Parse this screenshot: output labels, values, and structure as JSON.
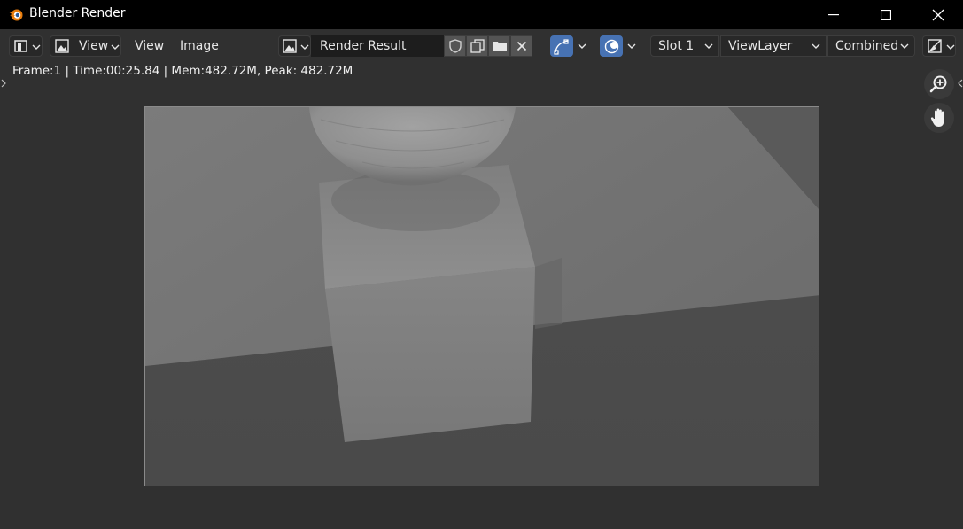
{
  "window": {
    "title": "Blender Render",
    "controls": [
      "minimize-icon",
      "maximize-icon",
      "close-icon"
    ]
  },
  "header": {
    "editor_type_icon": "image-editor-icon",
    "view_mode_label": "View",
    "menus": [
      "View",
      "Image"
    ],
    "image_name": "Render Result",
    "image_buttons": [
      "fake-user-shield-icon",
      "duplicate-icon",
      "open-folder-icon",
      "unlink-x-icon"
    ],
    "slot": "Slot 1",
    "view_layer": "ViewLayer",
    "pass": "Combined",
    "accent_color": "#4772b3"
  },
  "status": {
    "text": "Frame:1 | Time:00:25.84 | Mem:482.72M, Peak: 482.72M"
  },
  "navigation": [
    "zoom-in-icon",
    "pan-hand-icon"
  ],
  "render": {
    "description_icon": "render-result"
  }
}
